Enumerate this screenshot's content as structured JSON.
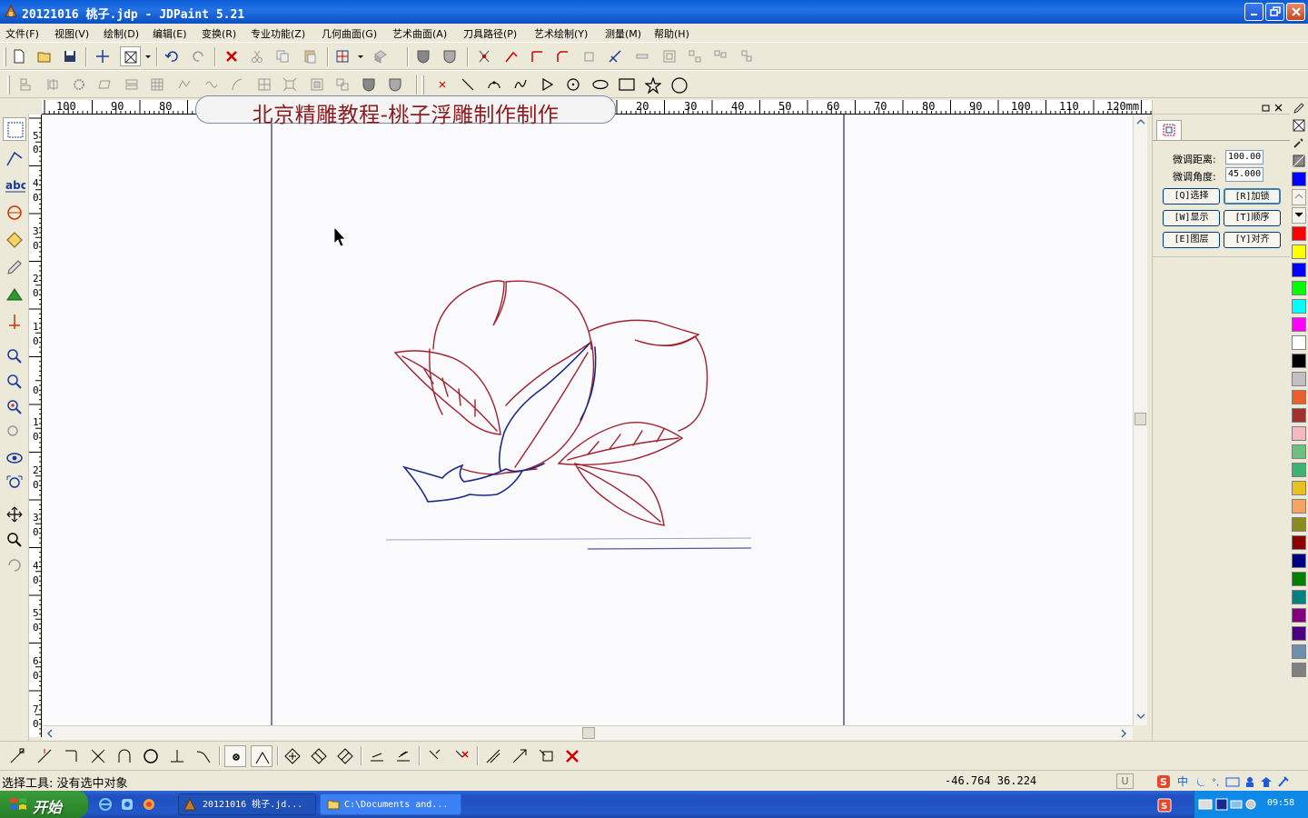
{
  "window": {
    "title": "20121016 桃子.jdp - JDPaint 5.21"
  },
  "menu": [
    "文件(F)",
    "视图(V)",
    "绘制(D)",
    "编辑(E)",
    "变换(R)",
    "专业功能(Z)",
    "几何曲面(G)",
    "艺术曲面(A)",
    "刀具路径(P)",
    "艺术绘制(Y)",
    "测量(M)",
    "帮助(H)"
  ],
  "banner": {
    "text": "北京精雕教程-桃子浮雕制作制作"
  },
  "ruler": {
    "horizontal_labels": [
      "100",
      "90",
      "80",
      "20",
      "30",
      "40",
      "50",
      "60",
      "70",
      "80",
      "90",
      "100",
      "110",
      "120mm"
    ],
    "vertical_labels": [
      "5",
      "0",
      "4",
      "0",
      "3",
      "0",
      "2",
      "0",
      "1",
      "0",
      "0",
      "1",
      "0",
      "2",
      "0",
      "3",
      "0",
      "4",
      "0",
      "5",
      "0",
      "6",
      "0",
      "7",
      "0"
    ]
  },
  "right_panel": {
    "fine_distance_label": "微调距离:",
    "fine_distance_value": "100.00",
    "fine_angle_label": "微调角度:",
    "fine_angle_value": "45.000",
    "buttons": [
      "[Q]选择",
      "[R]加锁",
      "[W]显示",
      "[T]顺序",
      "[E]图层",
      "[Y]对齐"
    ]
  },
  "palette": {
    "colors": [
      "#ff0000",
      "#ffff00",
      "#0000ff",
      "#00ff00",
      "#00ffff",
      "#ff00ff",
      "#ffffff",
      "#000000",
      "#c0c0c0",
      "#e8602c",
      "#a03030",
      "#f4b8c0",
      "#6fbf7f",
      "#3cb371",
      "#e8c020",
      "#f4a460",
      "#8b8b20",
      "#8b0000",
      "#000080",
      "#008000",
      "#008080",
      "#800080",
      "#4b0082",
      "#6f8fb0",
      "#808080"
    ],
    "top_colors": [
      "#0000ff"
    ]
  },
  "status": {
    "tool_text": "选择工具: 没有选中对象",
    "coords": "-46.764 36.224",
    "u_indicator": "U"
  },
  "taskbar": {
    "start_label": "开始",
    "task_1": "20121016 桃子.jd...",
    "task_2": "C:\\Documents and...",
    "clock": "09:58"
  }
}
